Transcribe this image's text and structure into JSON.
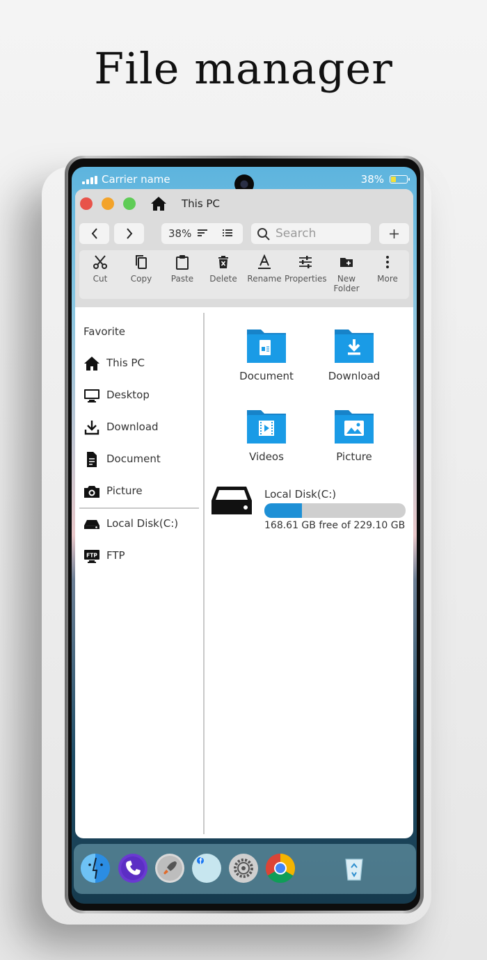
{
  "promo": {
    "title": "File manager"
  },
  "status_bar": {
    "carrier": "Carrier name",
    "battery_percent": "38%",
    "battery_level": 0.38
  },
  "window": {
    "title": "This PC",
    "zoom": "38%",
    "search_placeholder": "Search",
    "toolbar": [
      {
        "label": "Cut",
        "icon": "scissors-icon"
      },
      {
        "label": "Copy",
        "icon": "copy-icon"
      },
      {
        "label": "Paste",
        "icon": "clipboard-icon"
      },
      {
        "label": "Delete",
        "icon": "trash-icon"
      },
      {
        "label": "Rename",
        "icon": "text-underline-icon"
      },
      {
        "label": "Properties",
        "icon": "sliders-icon"
      },
      {
        "label": "New Folder",
        "icon": "new-folder-icon"
      },
      {
        "label": "More",
        "icon": "more-vertical-icon"
      }
    ]
  },
  "sidebar": {
    "section_label": "Favorite",
    "items": [
      {
        "label": "This PC",
        "icon": "home-icon"
      },
      {
        "label": "Desktop",
        "icon": "monitor-icon"
      },
      {
        "label": "Download",
        "icon": "download-icon"
      },
      {
        "label": "Document",
        "icon": "document-icon"
      },
      {
        "label": "Picture",
        "icon": "camera-icon"
      }
    ],
    "drives": [
      {
        "label": "Local Disk(C:)",
        "icon": "drive-icon"
      },
      {
        "label": "FTP",
        "icon": "ftp-icon"
      }
    ]
  },
  "main": {
    "folders": [
      {
        "label": "Document",
        "icon": "document-folder-icon"
      },
      {
        "label": "Download",
        "icon": "download-folder-icon"
      },
      {
        "label": "Videos",
        "icon": "video-folder-icon"
      },
      {
        "label": "Picture",
        "icon": "picture-folder-icon"
      }
    ],
    "disk": {
      "name": "Local Disk(C:)",
      "free_text": "168.61 GB free of 229.10 GB",
      "used_fraction": 0.264
    }
  },
  "dock": {
    "apps": [
      "finder-icon",
      "phone-icon",
      "launchpad-icon",
      "facebook-icon",
      "settings-icon",
      "chrome-icon"
    ],
    "trash": "recycle-bin-icon"
  },
  "colors": {
    "folder_blue": "#1a9be6",
    "accent_bar": "#1e90d6"
  }
}
